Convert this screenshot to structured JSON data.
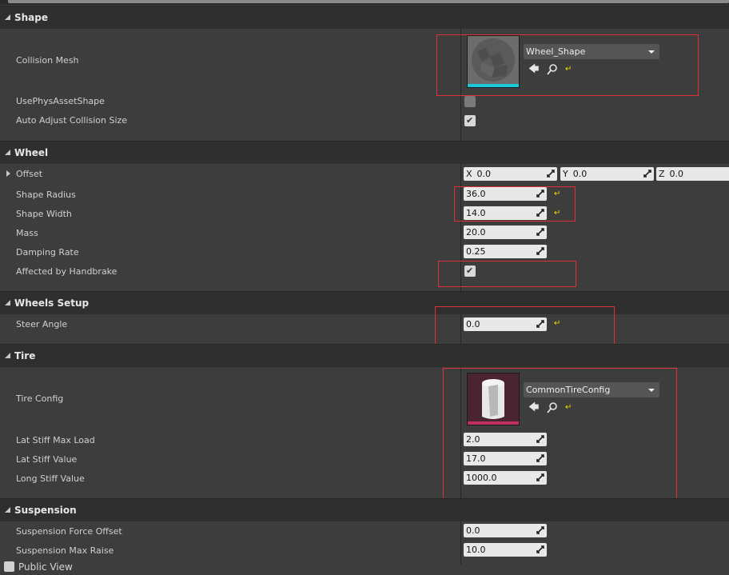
{
  "categories": {
    "shape": "Shape",
    "wheel": "Wheel",
    "wheels_setup": "Wheels Setup",
    "tire": "Tire",
    "suspension": "Suspension"
  },
  "shape": {
    "collision_mesh_label": "Collision Mesh",
    "collision_mesh_value": "Wheel_Shape",
    "use_phys_asset_shape_label": "UsePhysAssetShape",
    "use_phys_asset_shape_checked": false,
    "auto_adjust_label": "Auto Adjust Collision Size",
    "auto_adjust_checked": true
  },
  "wheel": {
    "offset_label": "Offset",
    "offset_x_axis": "X",
    "offset_x": "0.0",
    "offset_y_axis": "Y",
    "offset_y": "0.0",
    "offset_z_axis": "Z",
    "offset_z": "0.0",
    "shape_radius_label": "Shape Radius",
    "shape_radius": "36.0",
    "shape_width_label": "Shape Width",
    "shape_width": "14.0",
    "mass_label": "Mass",
    "mass": "20.0",
    "damping_rate_label": "Damping Rate",
    "damping_rate": "0.25",
    "affected_by_handbrake_label": "Affected by Handbrake",
    "affected_by_handbrake_checked": true
  },
  "wheels_setup": {
    "steer_angle_label": "Steer Angle",
    "steer_angle": "0.0"
  },
  "tire": {
    "tire_config_label": "Tire Config",
    "tire_config_value": "CommonTireConfig",
    "lat_stiff_max_load_label": "Lat Stiff Max Load",
    "lat_stiff_max_load": "2.0",
    "lat_stiff_value_label": "Lat Stiff Value",
    "lat_stiff_value": "17.0",
    "long_stiff_value_label": "Long Stiff Value",
    "long_stiff_value": "1000.0"
  },
  "suspension": {
    "force_offset_label": "Suspension Force Offset",
    "force_offset": "0.0",
    "max_raise_label": "Suspension Max Raise",
    "max_raise": "10.0"
  },
  "footer": {
    "public_view_label": "Public View",
    "public_view_checked": false
  },
  "icons": {
    "use_asset": "arrow-left-icon",
    "browse": "search-icon",
    "reset": "reset-to-default-icon",
    "check": "checkmark-icon"
  },
  "colors": {
    "highlight_box": "#e0303a",
    "reset_arrow": "#e8e000",
    "mesh_thumb_bar": "#18c8d8",
    "tire_thumb_bar": "#c03060"
  }
}
